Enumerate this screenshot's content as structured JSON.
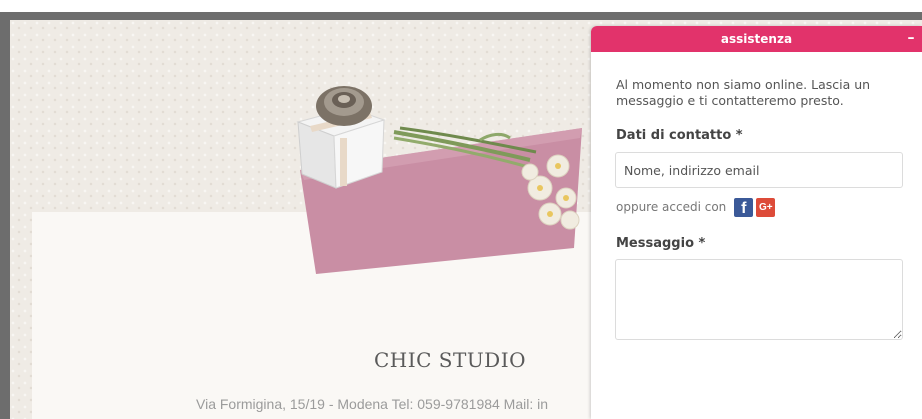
{
  "site": {
    "studio_name": "CHIC STUDIO",
    "address_line": "Via Formigina, 15/19 - Modena Tel: 059-9781984 Mail: in"
  },
  "chat": {
    "title": "assistenza",
    "minimize_label": "–",
    "offline_message": "Al momento non siamo online. Lascia un messaggio e ti contatteremo presto.",
    "contact_label": "Dati di contatto *",
    "contact_placeholder": "Nome, indirizzo email",
    "login_text": "oppure accedi con",
    "facebook_label": "f",
    "google_label": "G+",
    "message_label": "Messaggio *",
    "message_value": ""
  },
  "colors": {
    "header": "#e2336b",
    "facebook": "#3b5998",
    "google": "#dd4b39"
  },
  "icons": {
    "facebook": "facebook-icon",
    "google": "google-plus-icon"
  }
}
